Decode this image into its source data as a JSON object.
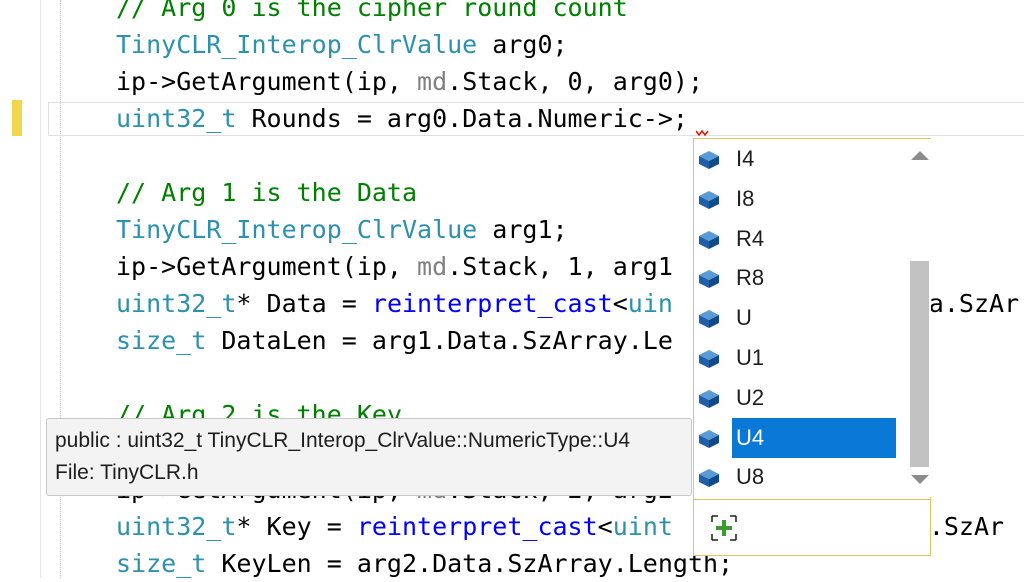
{
  "editor": {
    "lines": [
      {
        "parts": [
          {
            "cls": "cm",
            "text": "// Arg 0 is the cipher round count"
          }
        ]
      },
      {
        "parts": [
          {
            "cls": "ty",
            "text": "TinyCLR_Interop_ClrValue"
          },
          {
            "cls": "",
            "text": " arg0;"
          }
        ]
      },
      {
        "parts": [
          {
            "cls": "",
            "text": "ip->GetArgument(ip, "
          },
          {
            "cls": "md",
            "text": "md"
          },
          {
            "cls": "",
            "text": ".Stack, 0, arg0);"
          }
        ]
      },
      {
        "parts": [
          {
            "cls": "ty",
            "text": "uint32_t"
          },
          {
            "cls": "",
            "text": " Rounds = arg0.Data.Numeric->;"
          }
        ]
      },
      {
        "parts": []
      },
      {
        "parts": [
          {
            "cls": "cm",
            "text": "// Arg 1 is the Data"
          }
        ]
      },
      {
        "parts": [
          {
            "cls": "ty",
            "text": "TinyCLR_Interop_ClrValue"
          },
          {
            "cls": "",
            "text": " arg1;"
          }
        ]
      },
      {
        "parts": [
          {
            "cls": "",
            "text": "ip->GetArgument(ip, "
          },
          {
            "cls": "md",
            "text": "md"
          },
          {
            "cls": "",
            "text": ".Stack, 1, arg1"
          }
        ]
      },
      {
        "parts": [
          {
            "cls": "ty",
            "text": "uint32_t"
          },
          {
            "cls": "",
            "text": "* Data = "
          },
          {
            "cls": "kw",
            "text": "reinterpret_cast"
          },
          {
            "cls": "",
            "text": "<"
          },
          {
            "cls": "ty",
            "text": "uin"
          },
          {
            "cls": "",
            "text": "                ta.SzAr"
          }
        ]
      },
      {
        "parts": [
          {
            "cls": "ty",
            "text": "size_t"
          },
          {
            "cls": "",
            "text": " DataLen = arg1.Data.SzArray.Le"
          }
        ]
      },
      {
        "parts": []
      },
      {
        "parts": [
          {
            "cls": "cm",
            "text": "// Arg 2 is the Key"
          }
        ]
      },
      {
        "parts": []
      },
      {
        "parts": [
          {
            "cls": "",
            "text": "ip->GetArgument(ip, "
          },
          {
            "cls": "md",
            "text": "md"
          },
          {
            "cls": "",
            "text": ".Stack, 2, arg2"
          }
        ]
      },
      {
        "parts": [
          {
            "cls": "ty",
            "text": "uint32_t"
          },
          {
            "cls": "",
            "text": "* Key = "
          },
          {
            "cls": "kw",
            "text": "reinterpret_cast"
          },
          {
            "cls": "",
            "text": "<"
          },
          {
            "cls": "ty",
            "text": "uint"
          },
          {
            "cls": "",
            "text": "                a.SzAr"
          }
        ]
      },
      {
        "parts": [
          {
            "cls": "ty",
            "text": "size_t"
          },
          {
            "cls": "",
            "text": " KeyLen = arg2.Data.SzArray.Length;"
          }
        ]
      }
    ]
  },
  "completion": {
    "items": [
      "I4",
      "I8",
      "R4",
      "R8",
      "U",
      "U1",
      "U2",
      "U4",
      "U8"
    ],
    "selected": "U4",
    "item_icon": "field-icon",
    "footer_icon": "add-filter-icon"
  },
  "tooltip": {
    "signature": "public : uint32_t TinyCLR_Interop_ClrValue::NumericType::U4",
    "file": "File: TinyCLR.h"
  },
  "colors": {
    "comment": "#008000",
    "type": "#2b91af",
    "keyword": "#0000ff",
    "selection": "#0a78d7",
    "popup_border": "#e5c365",
    "change_marker": "#f2d64d"
  }
}
